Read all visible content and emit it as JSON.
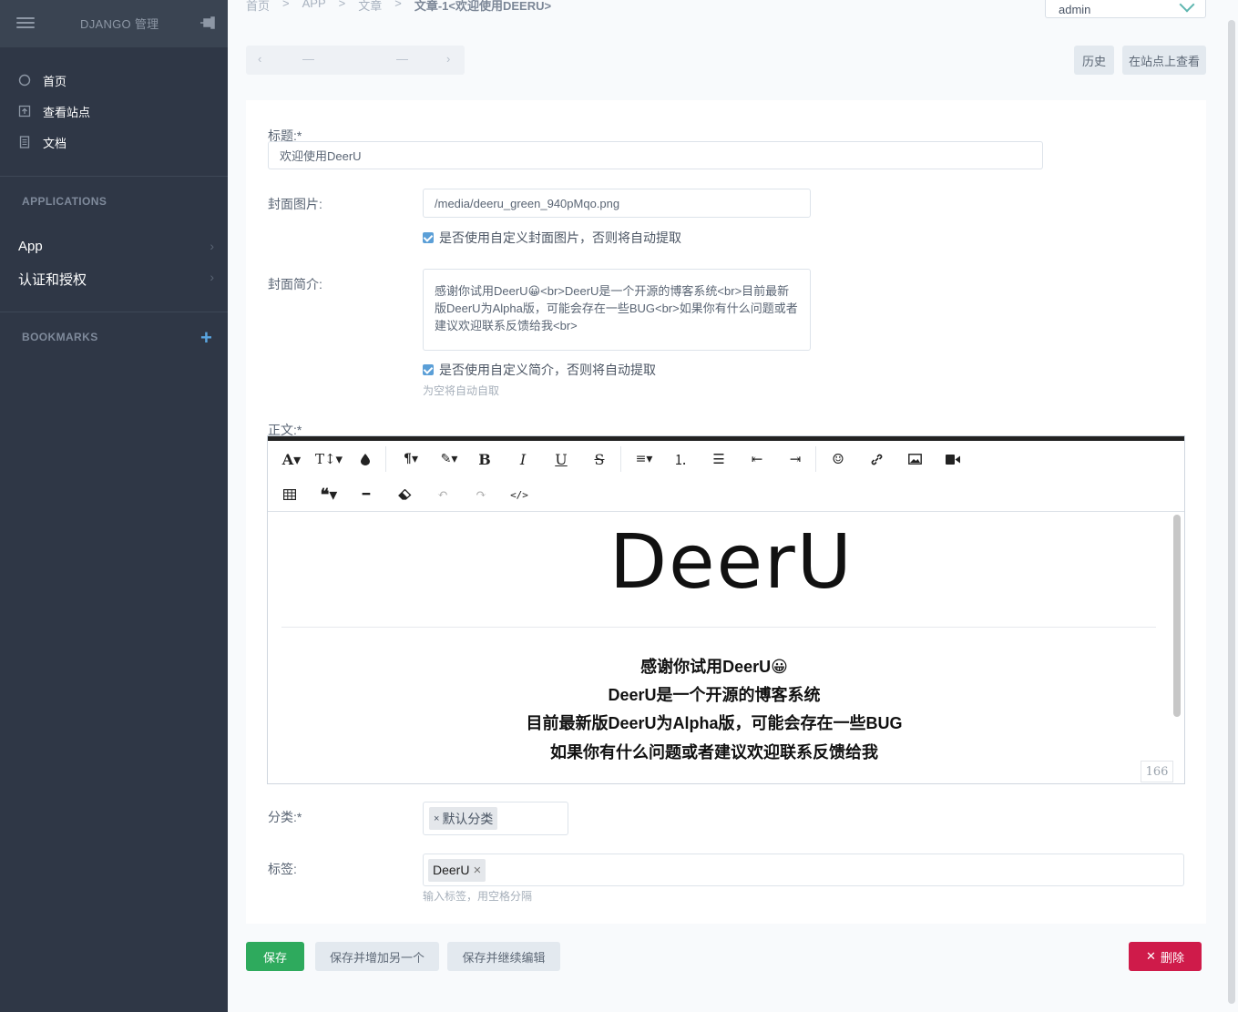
{
  "sidebar": {
    "title": "DJANGO 管理",
    "nav": [
      {
        "label": "首页",
        "icon": "circle-icon"
      },
      {
        "label": "查看站点",
        "icon": "upload-icon"
      },
      {
        "label": "文档",
        "icon": "document-icon"
      }
    ],
    "applications_heading": "APPLICATIONS",
    "apps": [
      {
        "label": "App"
      },
      {
        "label": "认证和授权"
      }
    ],
    "bookmarks_heading": "BOOKMARKS"
  },
  "header": {
    "breadcrumb": [
      "首页",
      "APP",
      "文章",
      "文章-1<欢迎使用DEERU>"
    ],
    "user": "admin",
    "pager_placeholder": "—",
    "history_label": "历史",
    "view_on_site_label": "在站点上查看"
  },
  "form": {
    "title_label": "标题:*",
    "title_value": "欢迎使用DeerU",
    "cover_label": "封面图片:",
    "cover_value": "/media/deeru_green_940pMqo.png",
    "cover_check_label": "是否使用自定义封面图片，否则将自动提取",
    "summary_label": "封面简介:",
    "summary_value": "感谢你试用DeerU😀<br>DeerU是一个开源的博客系统<br>目前最新版DeerU为Alpha版，可能会存在一些BUG<br>如果你有什么问题或者建议欢迎联系反馈给我<br>",
    "summary_check_label": "是否使用自定义简介，否则将自动提取",
    "summary_help": "为空将自动自取",
    "body_label": "正文:*",
    "category_label": "分类:*",
    "category_tag": "默认分类",
    "tags_label": "标签:",
    "tag_value": "DeerU",
    "tags_help": "输入标签，用空格分隔"
  },
  "editor": {
    "logo_text": "DeerU",
    "lines": [
      "感谢你试用DeerU😀",
      "DeerU是一个开源的博客系统",
      "目前最新版DeerU为Alpha版，可能会存在一些BUG",
      "如果你有什么问题或者建议欢迎联系反馈给我"
    ],
    "char_count": "166"
  },
  "actions": {
    "save": "保存",
    "save_add": "保存并增加另一个",
    "save_continue": "保存并继续编辑",
    "delete": "删除"
  },
  "colors": {
    "sidebar_bg": "#2f3746",
    "save_green": "#2eaa5d",
    "delete_red": "#cf1b4a",
    "check_blue": "#5b9fd7"
  }
}
